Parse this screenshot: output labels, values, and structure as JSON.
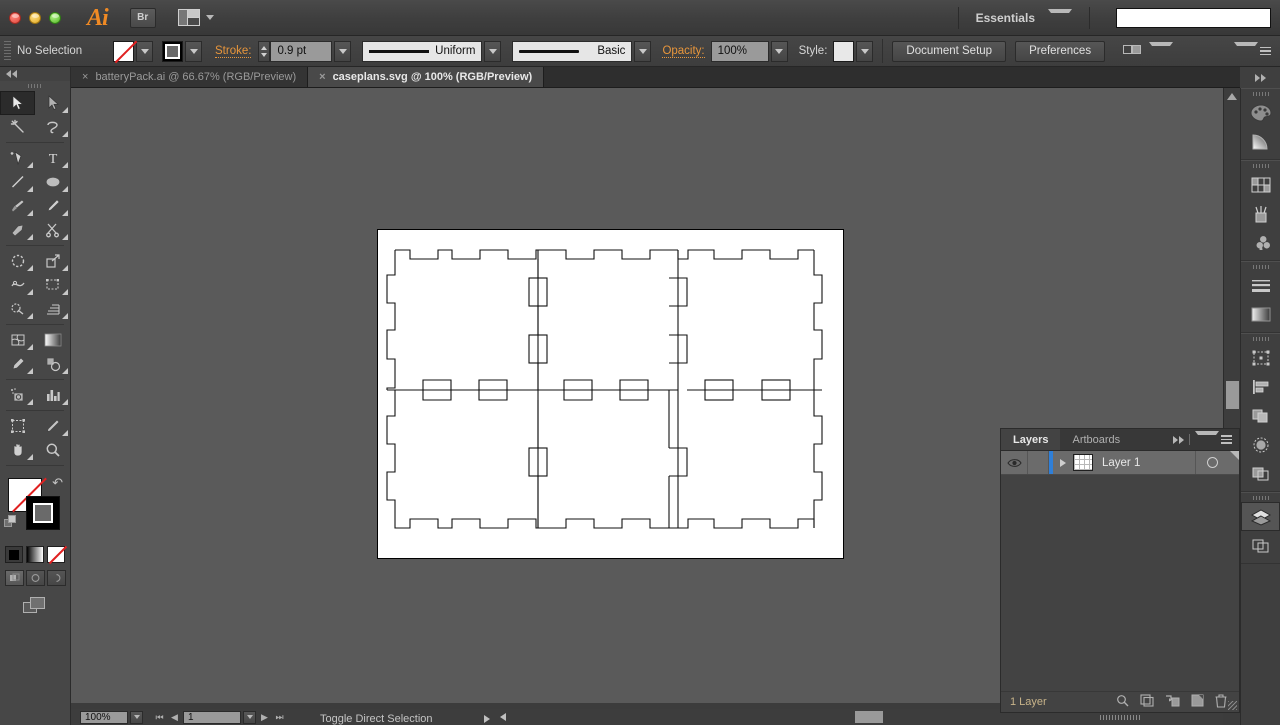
{
  "titlebar": {
    "app_logo": "Ai",
    "bridge_label": "Br",
    "arrange_icon": "arrange-documents-icon",
    "workspace_label": "Essentials",
    "search_value": "",
    "search_placeholder": ""
  },
  "control_bar": {
    "selection_status": "No Selection",
    "fill_swatch": "none-fill-swatch",
    "stroke_swatch": "black-stroke-swatch",
    "stroke_label": "Stroke:",
    "stroke_weight": "0.9 pt",
    "stroke_profile": "Uniform",
    "brush_definition": "Basic",
    "opacity_label": "Opacity:",
    "opacity_value": "100%",
    "style_label": "Style:",
    "document_setup": "Document Setup",
    "preferences": "Preferences",
    "select_similar_icon": "select-similar-objects-icon"
  },
  "tabs": [
    {
      "title": "batteryPack.ai @ 66.67% (RGB/Preview)",
      "active": false,
      "close": "×"
    },
    {
      "title": "caseplans.svg @ 100% (RGB/Preview)",
      "active": true,
      "close": "×"
    }
  ],
  "tools": [
    {
      "name": "selection-tool",
      "active": true
    },
    {
      "name": "direct-selection-tool",
      "active": false
    },
    {
      "name": "magic-wand-tool",
      "active": false
    },
    {
      "name": "lasso-tool",
      "active": false
    },
    {
      "name": "pen-tool",
      "active": false
    },
    {
      "name": "type-tool",
      "active": false
    },
    {
      "name": "line-segment-tool",
      "active": false
    },
    {
      "name": "ellipse-tool",
      "active": false
    },
    {
      "name": "paintbrush-tool",
      "active": false
    },
    {
      "name": "pencil-tool",
      "active": false
    },
    {
      "name": "blob-brush-tool",
      "active": false
    },
    {
      "name": "eraser-scissors-tool",
      "active": false
    },
    {
      "name": "rotate-tool",
      "active": false
    },
    {
      "name": "scale-tool",
      "active": false
    },
    {
      "name": "width-tool",
      "active": false
    },
    {
      "name": "free-transform-tool",
      "active": false
    },
    {
      "name": "shape-builder-tool",
      "active": false
    },
    {
      "name": "perspective-grid-tool",
      "active": false
    },
    {
      "name": "mesh-tool",
      "active": false
    },
    {
      "name": "gradient-tool",
      "active": false
    },
    {
      "name": "eyedropper-tool",
      "active": false
    },
    {
      "name": "blend-tool",
      "active": false
    },
    {
      "name": "symbol-sprayer-tool",
      "active": false
    },
    {
      "name": "column-graph-tool",
      "active": false
    },
    {
      "name": "artboard-tool",
      "active": false
    },
    {
      "name": "slice-tool",
      "active": false
    },
    {
      "name": "hand-tool",
      "active": false
    },
    {
      "name": "zoom-tool",
      "active": false
    }
  ],
  "toolbar_colors": {
    "fill": "none-fill-swatch",
    "stroke": "black-stroke-swatch",
    "swap_icon": "swap-fill-stroke-icon",
    "default_icon": "default-fill-stroke-icon",
    "mode_color": "color-mode-button",
    "mode_gradient": "gradient-mode-button",
    "mode_none": "none-mode-button",
    "draw_normal": "draw-normal-button",
    "draw_behind": "draw-behind-button",
    "draw_inside": "draw-inside-button",
    "screen_mode": "screen-mode-button"
  },
  "canvas": {
    "background_color": "#5a5a5a",
    "artboard_color": "#ffffff",
    "artwork_name": "laser-cut-case-plan"
  },
  "status_bar": {
    "zoom_level": "100%",
    "artboard_number": "1",
    "status_text": "Toggle Direct Selection"
  },
  "layers_panel": {
    "tabs": [
      {
        "label": "Layers",
        "active": true
      },
      {
        "label": "Artboards",
        "active": false
      }
    ],
    "collapse_icon": "expand-panel-icon",
    "menu_icon": "panel-menu-icon",
    "rows": [
      {
        "name": "Layer 1",
        "visibility_icon": "eye-icon",
        "expand_icon": "disclosure-triangle-icon",
        "thumbnail": "layer-thumbnail",
        "target_icon": "target-circle-icon",
        "selected": true
      }
    ],
    "footer_count": "1 Layer",
    "footer_icons": [
      "locate-object-icon",
      "make-clipping-mask-icon",
      "create-new-sublayer-icon",
      "create-new-layer-icon",
      "delete-selection-icon"
    ]
  },
  "dock_rail": [
    {
      "name": "color-panel-icon",
      "active": false
    },
    {
      "name": "color-guide-panel-icon",
      "active": false
    },
    {
      "name": "swatches-panel-icon",
      "active": false
    },
    {
      "name": "brushes-panel-icon",
      "active": false
    },
    {
      "name": "symbols-panel-icon",
      "active": false
    },
    {
      "name": "stroke-panel-icon",
      "active": false
    },
    {
      "name": "gradient-panel-icon",
      "active": false
    },
    {
      "name": "transform-panel-icon",
      "active": false
    },
    {
      "name": "align-panel-icon",
      "active": false
    },
    {
      "name": "pathfinder-panel-icon",
      "active": false
    },
    {
      "name": "transparency-panel-icon",
      "active": false
    },
    {
      "name": "appearance-panel-icon",
      "active": false
    },
    {
      "name": "layers-panel-icon",
      "active": true
    },
    {
      "name": "artboards-panel-icon",
      "active": false
    }
  ],
  "colors": {
    "accent_orange": "#e8963c",
    "selection_blue": "#2f7fd8",
    "panel_bg": "#434343",
    "chrome_bg": "#3c3c3c",
    "canvas_bg": "#5a5a5a"
  }
}
